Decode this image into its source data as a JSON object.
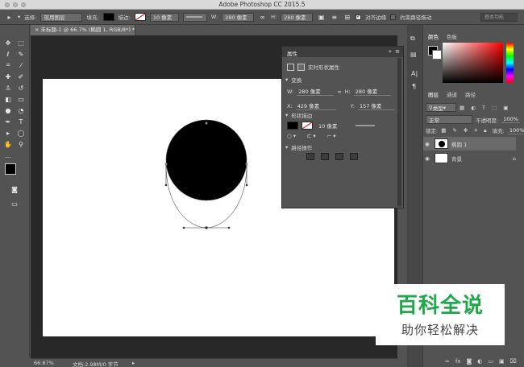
{
  "window": {
    "title": "Adobe Photoshop CC 2015.5"
  },
  "options_bar": {
    "select_label": "选择:",
    "select_value": "现用图层",
    "fill_label": "填充:",
    "stroke_label": "描边:",
    "stroke_width": "10 像素",
    "width_label": "W:",
    "width_value": "280 像素",
    "height_label": "H:",
    "height_value": "280 像素",
    "align_edges_label": "对齐边缘",
    "constrain_path_label": "约束路径拖动",
    "workspace_placeholder": "基本功能"
  },
  "document": {
    "tab_title": "未标题-1 @ 66.7% (椭圆 1, RGB/8*) *",
    "zoom": "66.67%",
    "doc_info": "文档:2.98M/0 字节"
  },
  "properties_panel": {
    "title": "属性",
    "subtitle": "实时形状属性",
    "section_transform": "变换",
    "w_label": "W:",
    "w_value": "280 像素",
    "h_label": "H:",
    "h_value": "280 像素",
    "x_label": "X:",
    "x_value": "429 像素",
    "y_label": "Y:",
    "y_value": "157 像素",
    "section_shape": "形状描边",
    "stroke_width": "10 像素",
    "section_path_ops": "路径操作"
  },
  "color_panel": {
    "tabs": [
      "颜色",
      "色板"
    ]
  },
  "layers_panel": {
    "tabs": [
      "图层",
      "通道",
      "路径"
    ],
    "filter_label": "类型",
    "blend_mode": "正常",
    "opacity_label": "不透明度:",
    "opacity_value": "100%",
    "lock_label": "锁定:",
    "fill_label": "填充:",
    "fill_value": "100%",
    "layers": [
      {
        "name": "椭圆 1"
      },
      {
        "name": "背景"
      }
    ]
  },
  "watermark": {
    "line1": "百科全说",
    "line2": "助你轻松解决"
  },
  "colors": {
    "accent_green": "#1fa84a",
    "panel_bg": "#535353",
    "canvas_bg": "#282828"
  }
}
